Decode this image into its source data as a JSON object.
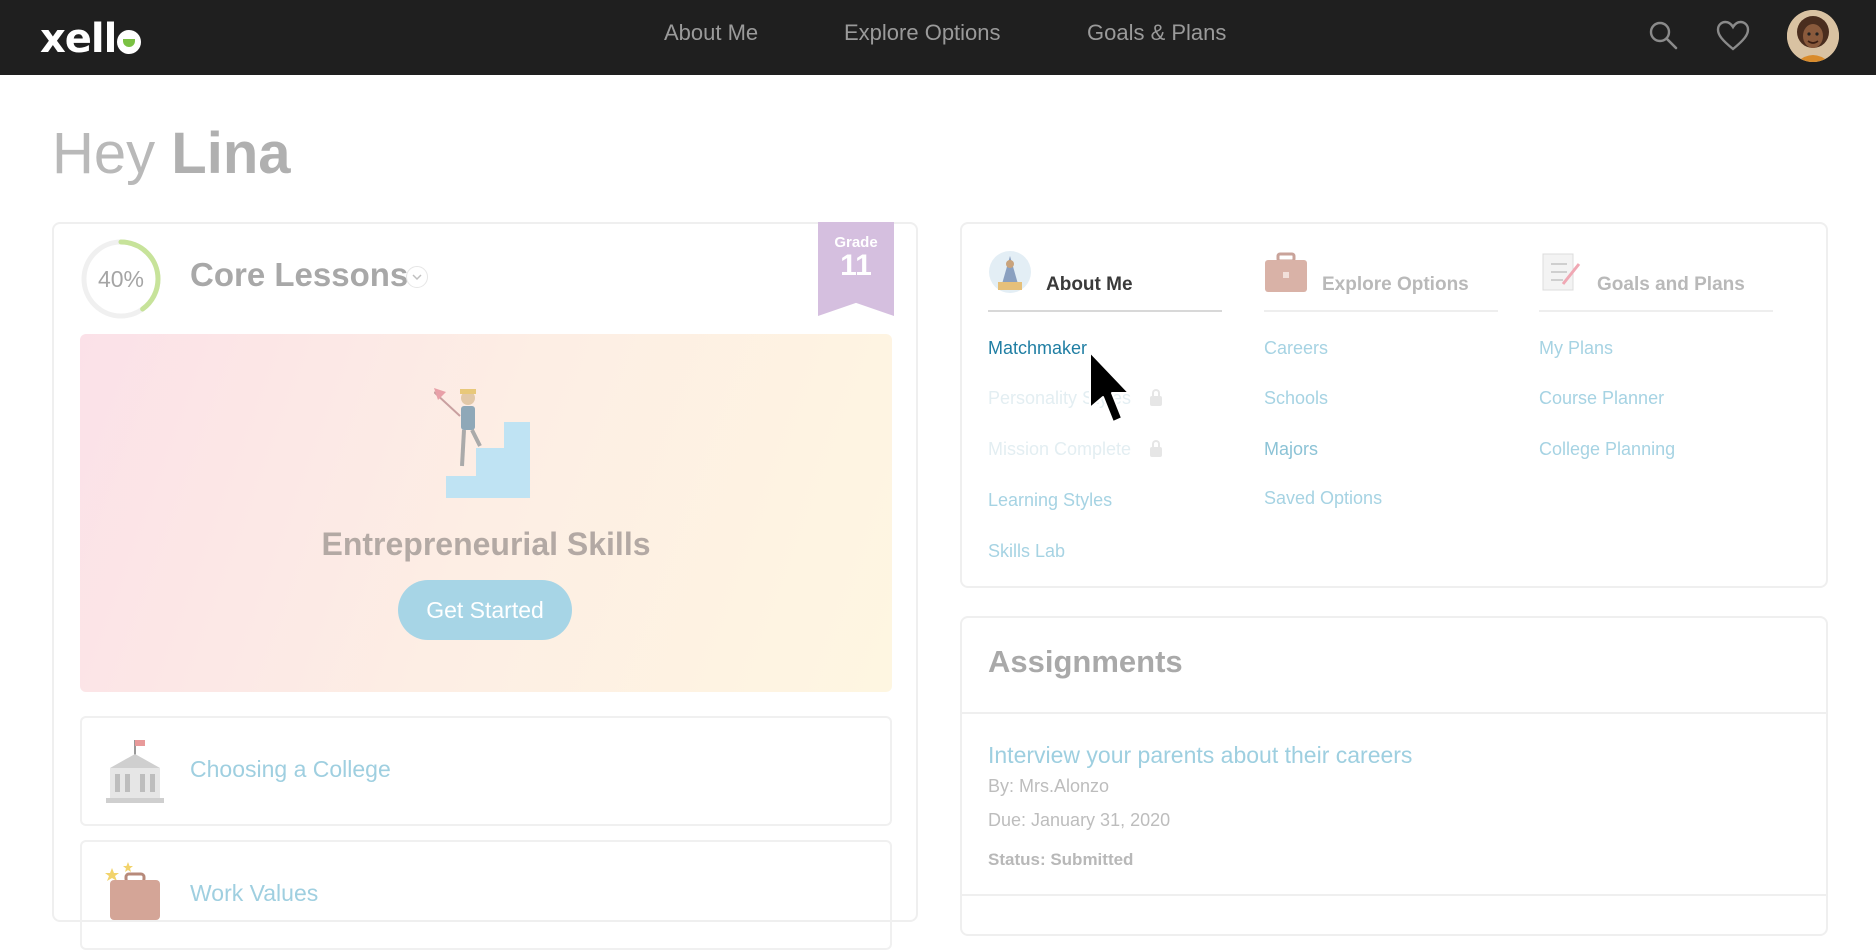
{
  "brand": {
    "name": "xell",
    "accent": "#7ac143"
  },
  "nav": {
    "items": [
      {
        "label": "About Me"
      },
      {
        "label": "Explore Options"
      },
      {
        "label": "Goals & Plans"
      }
    ],
    "icons": [
      "search-icon",
      "heart-icon",
      "avatar"
    ]
  },
  "greeting": {
    "prefix": "Hey",
    "name": "Lina"
  },
  "lessons": {
    "progress_percent": 40,
    "progress_text": "40%",
    "title": "Core Lessons",
    "grade_label": "Grade",
    "grade_number": "11",
    "featured": {
      "title": "Entrepreneurial Skills",
      "button_label": "Get Started"
    },
    "rows": [
      {
        "label": "Choosing a College",
        "icon": "college-building-icon"
      },
      {
        "label": "Work Values",
        "icon": "briefcase-stars-icon"
      }
    ]
  },
  "about_menu": {
    "columns": [
      {
        "title": "About Me",
        "title_color": "#3a3a3a",
        "icon": "about-me-icon",
        "links": [
          {
            "label": "Matchmaker",
            "color": "#1f7ea3"
          },
          {
            "label": "Personality Styles",
            "locked": true
          },
          {
            "label": "Mission Complete",
            "locked": true
          },
          {
            "label": "Learning Styles"
          },
          {
            "label": "Skills Lab"
          }
        ]
      },
      {
        "title": "Explore Options",
        "title_color": "#b9b9b9",
        "icon": "briefcase-icon",
        "links": [
          {
            "label": "Careers"
          },
          {
            "label": "Schools"
          },
          {
            "label": "Majors",
            "color": "#8cc3d6"
          },
          {
            "label": "Saved Options"
          }
        ]
      },
      {
        "title": "Goals and Plans",
        "title_color": "#b9b9b9",
        "icon": "checklist-icon",
        "links": [
          {
            "label": "My Plans"
          },
          {
            "label": "Course Planner"
          },
          {
            "label": "College Planning"
          }
        ]
      }
    ]
  },
  "assignments": {
    "title": "Assignments",
    "items": [
      {
        "title": "Interview your parents about their careers",
        "by": "By: Mrs.Alonzo",
        "due": "Due: January 31, 2020",
        "status": "Status: Submitted"
      }
    ]
  }
}
